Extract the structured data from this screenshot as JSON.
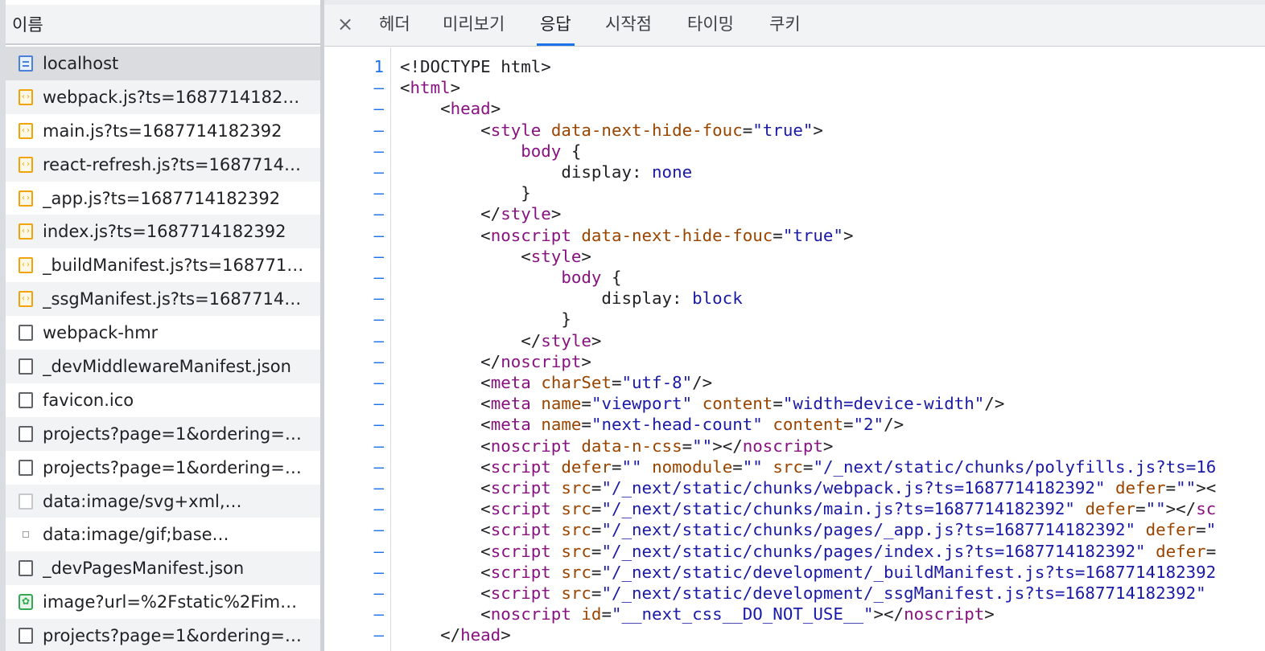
{
  "request_list": {
    "header": "이름",
    "items": [
      {
        "name": "localhost",
        "type": "doc",
        "selected": true
      },
      {
        "name": "webpack.js?ts=1687714182…",
        "type": "js"
      },
      {
        "name": "main.js?ts=1687714182392",
        "type": "js"
      },
      {
        "name": "react-refresh.js?ts=1687714…",
        "type": "js"
      },
      {
        "name": "_app.js?ts=1687714182392",
        "type": "js"
      },
      {
        "name": "index.js?ts=1687714182392",
        "type": "js"
      },
      {
        "name": "_buildManifest.js?ts=168771…",
        "type": "js"
      },
      {
        "name": "_ssgManifest.js?ts=1687714…",
        "type": "js"
      },
      {
        "name": "webpack-hmr",
        "type": "blank"
      },
      {
        "name": "_devMiddlewareManifest.json",
        "type": "blank"
      },
      {
        "name": "favicon.ico",
        "type": "blank"
      },
      {
        "name": "projects?page=1&ordering=…",
        "type": "blank"
      },
      {
        "name": "projects?page=1&ordering=…",
        "type": "blank"
      },
      {
        "name": "data:image/svg+xml,…",
        "type": "svg"
      },
      {
        "name": "data:image/gif;base…",
        "type": "gif"
      },
      {
        "name": "_devPagesManifest.json",
        "type": "blank"
      },
      {
        "name": "image?url=%2Fstatic%2Fim…",
        "type": "img"
      },
      {
        "name": "projects?page=1&ordering=…",
        "type": "blank"
      }
    ]
  },
  "tabs": {
    "close": "×",
    "items": [
      "헤더",
      "미리보기",
      "응답",
      "시작점",
      "타이밍",
      "쿠키"
    ],
    "active": "응답"
  },
  "response": {
    "first_line_number": "1",
    "collapse_marker": "–",
    "lines": [
      [
        [
          "pun",
          "<!DOCTYPE html>"
        ]
      ],
      [
        [
          "pun",
          "<"
        ],
        [
          "tag",
          "html"
        ],
        [
          "pun",
          ">"
        ]
      ],
      [
        [
          "pun",
          "    <"
        ],
        [
          "tag",
          "head"
        ],
        [
          "pun",
          ">"
        ]
      ],
      [
        [
          "pun",
          "        <"
        ],
        [
          "tag",
          "style"
        ],
        [
          "pun",
          " "
        ],
        [
          "attr",
          "data-next-hide-fouc"
        ],
        [
          "pun",
          "="
        ],
        [
          "val",
          "\"true\""
        ],
        [
          "pun",
          ">"
        ]
      ],
      [
        [
          "pun",
          "            "
        ],
        [
          "tag",
          "body"
        ],
        [
          "pun",
          " {"
        ]
      ],
      [
        [
          "pun",
          "                display: "
        ],
        [
          "val",
          "none"
        ]
      ],
      [
        [
          "pun",
          "            }"
        ]
      ],
      [
        [
          "pun",
          "        </"
        ],
        [
          "tag",
          "style"
        ],
        [
          "pun",
          ">"
        ]
      ],
      [
        [
          "pun",
          "        <"
        ],
        [
          "tag",
          "noscript"
        ],
        [
          "pun",
          " "
        ],
        [
          "attr",
          "data-next-hide-fouc"
        ],
        [
          "pun",
          "="
        ],
        [
          "val",
          "\"true\""
        ],
        [
          "pun",
          ">"
        ]
      ],
      [
        [
          "pun",
          "            <"
        ],
        [
          "tag",
          "style"
        ],
        [
          "pun",
          ">"
        ]
      ],
      [
        [
          "pun",
          "                "
        ],
        [
          "tag",
          "body"
        ],
        [
          "pun",
          " {"
        ]
      ],
      [
        [
          "pun",
          "                    display: "
        ],
        [
          "val",
          "block"
        ]
      ],
      [
        [
          "pun",
          "                }"
        ]
      ],
      [
        [
          "pun",
          "            </"
        ],
        [
          "tag",
          "style"
        ],
        [
          "pun",
          ">"
        ]
      ],
      [
        [
          "pun",
          "        </"
        ],
        [
          "tag",
          "noscript"
        ],
        [
          "pun",
          ">"
        ]
      ],
      [
        [
          "pun",
          "        <"
        ],
        [
          "tag",
          "meta"
        ],
        [
          "pun",
          " "
        ],
        [
          "attr",
          "charSet"
        ],
        [
          "pun",
          "="
        ],
        [
          "val",
          "\"utf-8\""
        ],
        [
          "pun",
          "/>"
        ]
      ],
      [
        [
          "pun",
          "        <"
        ],
        [
          "tag",
          "meta"
        ],
        [
          "pun",
          " "
        ],
        [
          "attr",
          "name"
        ],
        [
          "pun",
          "="
        ],
        [
          "val",
          "\"viewport\""
        ],
        [
          "pun",
          " "
        ],
        [
          "attr",
          "content"
        ],
        [
          "pun",
          "="
        ],
        [
          "val",
          "\"width=device-width\""
        ],
        [
          "pun",
          "/>"
        ]
      ],
      [
        [
          "pun",
          "        <"
        ],
        [
          "tag",
          "meta"
        ],
        [
          "pun",
          " "
        ],
        [
          "attr",
          "name"
        ],
        [
          "pun",
          "="
        ],
        [
          "val",
          "\"next-head-count\""
        ],
        [
          "pun",
          " "
        ],
        [
          "attr",
          "content"
        ],
        [
          "pun",
          "="
        ],
        [
          "val",
          "\"2\""
        ],
        [
          "pun",
          "/>"
        ]
      ],
      [
        [
          "pun",
          "        <"
        ],
        [
          "tag",
          "noscript"
        ],
        [
          "pun",
          " "
        ],
        [
          "attr",
          "data-n-css"
        ],
        [
          "pun",
          "="
        ],
        [
          "val",
          "\"\""
        ],
        [
          "pun",
          "></"
        ],
        [
          "tag",
          "noscript"
        ],
        [
          "pun",
          ">"
        ]
      ],
      [
        [
          "pun",
          "        <"
        ],
        [
          "tag",
          "script"
        ],
        [
          "pun",
          " "
        ],
        [
          "attr",
          "defer"
        ],
        [
          "pun",
          "="
        ],
        [
          "val",
          "\"\""
        ],
        [
          "pun",
          " "
        ],
        [
          "attr",
          "nomodule"
        ],
        [
          "pun",
          "="
        ],
        [
          "val",
          "\"\""
        ],
        [
          "pun",
          " "
        ],
        [
          "attr",
          "src"
        ],
        [
          "pun",
          "="
        ],
        [
          "val",
          "\"/_next/static/chunks/polyfills.js?ts=16"
        ]
      ],
      [
        [
          "pun",
          "        <"
        ],
        [
          "tag",
          "script"
        ],
        [
          "pun",
          " "
        ],
        [
          "attr",
          "src"
        ],
        [
          "pun",
          "="
        ],
        [
          "val",
          "\"/_next/static/chunks/webpack.js?ts=1687714182392\""
        ],
        [
          "pun",
          " "
        ],
        [
          "attr",
          "defer"
        ],
        [
          "pun",
          "="
        ],
        [
          "val",
          "\"\""
        ],
        [
          "pun",
          "><"
        ]
      ],
      [
        [
          "pun",
          "        <"
        ],
        [
          "tag",
          "script"
        ],
        [
          "pun",
          " "
        ],
        [
          "attr",
          "src"
        ],
        [
          "pun",
          "="
        ],
        [
          "val",
          "\"/_next/static/chunks/main.js?ts=1687714182392\""
        ],
        [
          "pun",
          " "
        ],
        [
          "attr",
          "defer"
        ],
        [
          "pun",
          "="
        ],
        [
          "val",
          "\"\""
        ],
        [
          "pun",
          "></"
        ],
        [
          "tag",
          "sc"
        ]
      ],
      [
        [
          "pun",
          "        <"
        ],
        [
          "tag",
          "script"
        ],
        [
          "pun",
          " "
        ],
        [
          "attr",
          "src"
        ],
        [
          "pun",
          "="
        ],
        [
          "val",
          "\"/_next/static/chunks/pages/_app.js?ts=1687714182392\""
        ],
        [
          "pun",
          " "
        ],
        [
          "attr",
          "defer"
        ],
        [
          "pun",
          "="
        ],
        [
          "val",
          "\""
        ]
      ],
      [
        [
          "pun",
          "        <"
        ],
        [
          "tag",
          "script"
        ],
        [
          "pun",
          " "
        ],
        [
          "attr",
          "src"
        ],
        [
          "pun",
          "="
        ],
        [
          "val",
          "\"/_next/static/chunks/pages/index.js?ts=1687714182392\""
        ],
        [
          "pun",
          " "
        ],
        [
          "attr",
          "defer"
        ],
        [
          "pun",
          "="
        ]
      ],
      [
        [
          "pun",
          "        <"
        ],
        [
          "tag",
          "script"
        ],
        [
          "pun",
          " "
        ],
        [
          "attr",
          "src"
        ],
        [
          "pun",
          "="
        ],
        [
          "val",
          "\"/_next/static/development/_buildManifest.js?ts=1687714182392"
        ]
      ],
      [
        [
          "pun",
          "        <"
        ],
        [
          "tag",
          "script"
        ],
        [
          "pun",
          " "
        ],
        [
          "attr",
          "src"
        ],
        [
          "pun",
          "="
        ],
        [
          "val",
          "\"/_next/static/development/_ssgManifest.js?ts=1687714182392\""
        ]
      ],
      [
        [
          "pun",
          "        <"
        ],
        [
          "tag",
          "noscript"
        ],
        [
          "pun",
          " "
        ],
        [
          "attr",
          "id"
        ],
        [
          "pun",
          "="
        ],
        [
          "val",
          "\"__next_css__DO_NOT_USE__\""
        ],
        [
          "pun",
          "></"
        ],
        [
          "tag",
          "noscript"
        ],
        [
          "pun",
          ">"
        ]
      ],
      [
        [
          "pun",
          "    </"
        ],
        [
          "tag",
          "head"
        ],
        [
          "pun",
          ">"
        ]
      ]
    ]
  },
  "colors": {
    "tag": "#881280",
    "attribute": "#994500",
    "value": "#1a1aa6",
    "active_tab_underline": "#1a73e8",
    "line_number": "#1a73e8",
    "js_icon": "#f0a30a",
    "doc_icon": "#4a7fdc",
    "image_icon": "#34a853"
  }
}
